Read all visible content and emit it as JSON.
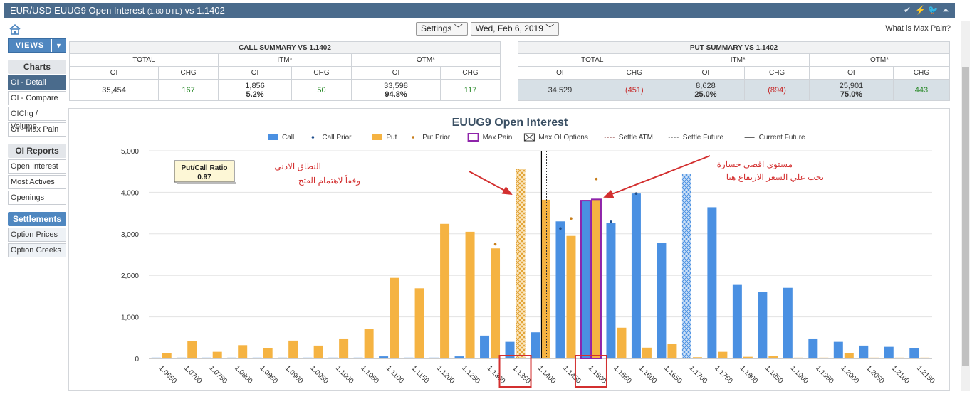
{
  "window": {
    "title_main": "EUR/USD EUUG9 Open Interest",
    "title_dte": "(1.80 DTE)",
    "title_vs": "vs  1.1402"
  },
  "toolbar": {
    "settings_label": "Settings",
    "date_label": "Wed, Feb 6, 2019",
    "max_pain_link": "What is Max Pain?",
    "icons": [
      "check-icon",
      "lightning-icon",
      "twitter-icon",
      "collapse-icon"
    ]
  },
  "sidebar": {
    "views_label": "VIEWS",
    "charts_header": "Charts",
    "charts": [
      "OI - Detail",
      "OI - Compare",
      "OIChg / Volume",
      "OI - Max Pain"
    ],
    "reports_header": "OI Reports",
    "reports": [
      "Open Interest",
      "Most Actives",
      "Openings"
    ],
    "settlements_header": "Settlements",
    "settlements": [
      "Option Prices",
      "Option Greeks"
    ]
  },
  "call_summary": {
    "title": "CALL SUMMARY VS 1.1402",
    "groups": [
      "TOTAL",
      "ITM*",
      "OTM*"
    ],
    "cols": [
      "OI",
      "CHG",
      "OI",
      "CHG",
      "OI",
      "CHG"
    ],
    "total_oi": "35,454",
    "total_chg": "167",
    "itm_oi": "1,856",
    "itm_pct": "5.2%",
    "itm_chg": "50",
    "otm_oi": "33,598",
    "otm_pct": "94.8%",
    "otm_chg": "117"
  },
  "put_summary": {
    "title": "PUT SUMMARY VS 1.1402",
    "groups": [
      "TOTAL",
      "ITM*",
      "OTM*"
    ],
    "cols": [
      "OI",
      "CHG",
      "OI",
      "CHG",
      "OI",
      "CHG"
    ],
    "total_oi": "34,529",
    "total_chg": "(451)",
    "itm_oi": "8,628",
    "itm_pct": "25.0%",
    "itm_chg": "(894)",
    "otm_oi": "25,901",
    "otm_pct": "75.0%",
    "otm_chg": "443"
  },
  "chart_data": {
    "type": "bar",
    "title": "EUUG9 Open Interest",
    "ylim": [
      0,
      5000
    ],
    "y_ticks": [
      "0",
      "1,000",
      "2,000",
      "3,000",
      "4,000",
      "5,000"
    ],
    "y_tick_values": [
      0,
      1000,
      2000,
      3000,
      4000,
      5000
    ],
    "categories": [
      "1.0650",
      "1.0700",
      "1.0750",
      "1.0800",
      "1.0850",
      "1.0900",
      "1.0950",
      "1.1000",
      "1.1050",
      "1.1100",
      "1.1150",
      "1.1200",
      "1.1250",
      "1.1300",
      "1.1350",
      "1.1400",
      "1.1450",
      "1.1500",
      "1.1550",
      "1.1600",
      "1.1650",
      "1.1700",
      "1.1750",
      "1.1800",
      "1.1850",
      "1.1900",
      "1.1950",
      "1.2000",
      "1.2050",
      "1.2100",
      "1.2150"
    ],
    "series": [
      {
        "name": "Call",
        "color": "#4a90e2",
        "values": [
          20,
          20,
          20,
          20,
          20,
          20,
          20,
          20,
          20,
          50,
          20,
          20,
          50,
          550,
          400,
          630,
          3300,
          3800,
          3260,
          3970,
          2780,
          4440,
          3640,
          1770,
          1600,
          1700,
          480,
          400,
          310,
          280,
          250
        ]
      },
      {
        "name": "Put",
        "color": "#f5b342",
        "values": [
          120,
          420,
          160,
          320,
          240,
          430,
          310,
          480,
          710,
          1940,
          1690,
          3240,
          3050,
          2650,
          4570,
          3820,
          2950,
          3830,
          740,
          260,
          350,
          30,
          160,
          40,
          60,
          20,
          20,
          120,
          20,
          20,
          20
        ]
      }
    ],
    "call_prior": [
      null,
      null,
      null,
      null,
      null,
      null,
      null,
      null,
      null,
      null,
      null,
      null,
      null,
      null,
      null,
      null,
      3130,
      null,
      3290,
      3970,
      null,
      null,
      null,
      null,
      null,
      null,
      null,
      null,
      null,
      null,
      null
    ],
    "put_prior": [
      null,
      null,
      null,
      null,
      null,
      null,
      null,
      null,
      null,
      null,
      null,
      null,
      null,
      2750,
      null,
      null,
      3370,
      4320,
      null,
      null,
      null,
      null,
      null,
      null,
      null,
      null,
      null,
      null,
      null,
      null,
      null
    ],
    "max_pain_strike": "1.1500",
    "max_oi_strikes": {
      "put": "1.1350",
      "call": "1.1700"
    },
    "current_future": 1.1402,
    "settle_future": 1.1412,
    "legend": [
      "Call",
      "Call Prior",
      "Put",
      "Put Prior",
      "Max Pain",
      "Max OI Options",
      "Settle ATM",
      "Settle Future",
      "Current Future"
    ],
    "legend_position": "top",
    "grid": true,
    "ratio_label": "Put/Call Ratio",
    "ratio_value": "0.97",
    "annotations": {
      "left_line1": "النطاق الادني",
      "left_line2": "وفقاً لاهتمام الفتح",
      "right_line1": "مستوي اقصي خسارة",
      "right_line2": "يجب علي السعر الارتفاع هنا"
    }
  }
}
